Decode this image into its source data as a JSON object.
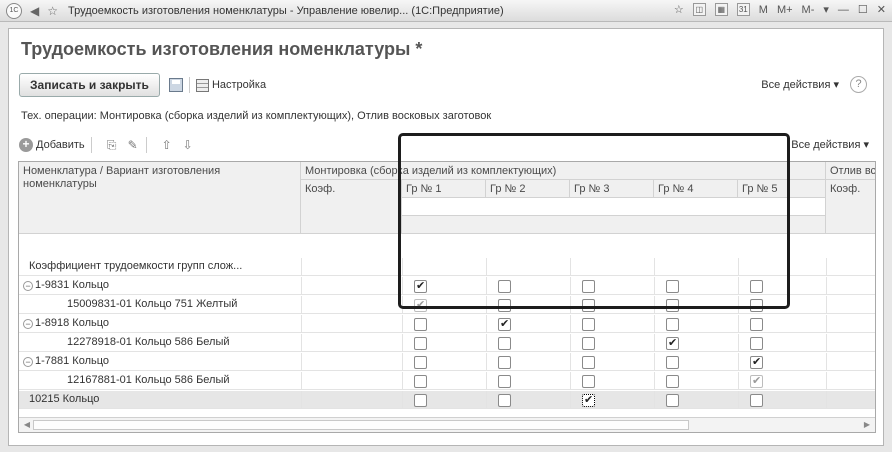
{
  "titlebar": {
    "logo": "1С",
    "title": "Трудоемкость изготовления номенклатуры - Управление ювелир...  (1С:Предприятие)",
    "controls": [
      "M",
      "M+",
      "M-"
    ]
  },
  "form": {
    "title": "Трудоемкость изготовления номенклатуры *",
    "save_close_label": "Записать и закрыть",
    "settings_label": "Настройка",
    "all_actions_label": "Все действия ▾",
    "help_label": "?",
    "operations_line": "Тех. операции: Монтировка (сборка изделий из комплектующих), Отлив восковых заготовок"
  },
  "table_bar": {
    "add_label": "Добавить",
    "all_actions_label": "Все действия ▾"
  },
  "grid": {
    "col_name_header": "Номенклатура / Вариант изготовления номенклатуры",
    "group1_header": "Монтировка (сборка изделий из комплектующих)",
    "group2_header": "Отлив вс",
    "coef_header": "Коэф.",
    "gr_headers": [
      "Гр № 1",
      "Гр № 2",
      "Гр № 3",
      "Гр № 4",
      "Гр № 5"
    ],
    "coef_header2": "Коэф.",
    "rows": [
      {
        "name": "Коэффициент трудоемкости групп слож...",
        "level": 1,
        "toggle": "",
        "checks": null
      },
      {
        "name": "1-9831 Кольцо",
        "level": 0,
        "toggle": "−",
        "checks": [
          1,
          0,
          0,
          0,
          0
        ],
        "dim": []
      },
      {
        "name": "15009831-01 Кольцо 751 Желтый",
        "level": 2,
        "toggle": "",
        "checks": [
          1,
          0,
          0,
          0,
          0
        ],
        "dim": [
          0
        ]
      },
      {
        "name": "1-8918 Кольцо",
        "level": 0,
        "toggle": "−",
        "checks": [
          0,
          1,
          0,
          0,
          0
        ],
        "dim": []
      },
      {
        "name": "12278918-01 Кольцо 586 Белый",
        "level": 2,
        "toggle": "",
        "checks": [
          0,
          0,
          0,
          1,
          0
        ],
        "dim": []
      },
      {
        "name": "1-7881 Кольцо",
        "level": 0,
        "toggle": "−",
        "checks": [
          0,
          0,
          0,
          0,
          1
        ],
        "dim": []
      },
      {
        "name": "12167881-01 Кольцо 586 Белый",
        "level": 2,
        "toggle": "",
        "checks": [
          0,
          0,
          0,
          0,
          1
        ],
        "dim": [
          4
        ]
      },
      {
        "name": "10215 Кольцо",
        "level": 1,
        "toggle": "",
        "checks": [
          0,
          0,
          1,
          0,
          0
        ],
        "dim": [],
        "selected": true
      }
    ],
    "scroll_marker": "r"
  }
}
